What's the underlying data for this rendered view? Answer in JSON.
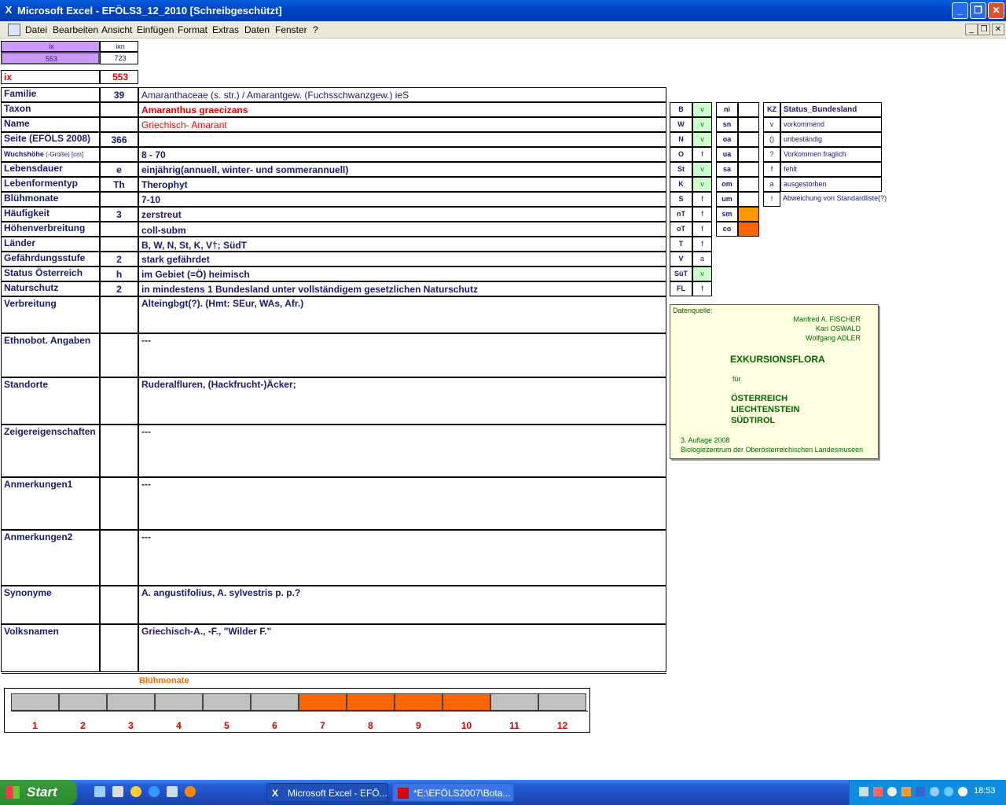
{
  "window": {
    "title": "Microsoft Excel - EFÖLS3_12_2010  [Schreibgeschützt]",
    "min": "_",
    "max": "❐",
    "close": "✕"
  },
  "menu": [
    "Datei",
    "Bearbeiten",
    "Ansicht",
    "Einfügen",
    "Format",
    "Extras",
    "Daten",
    "Fenster",
    "?"
  ],
  "mdi": {
    "min": "_",
    "restore": "❐",
    "close": "✕"
  },
  "index": {
    "ix_head": "ix",
    "ixn_head": "ixn",
    "ix_val": "553",
    "ixn_val": "723",
    "ix_label": "ix",
    "ix_big": "553"
  },
  "rows": [
    {
      "label": "Familie",
      "code": "39",
      "value": "Amaranthaceae (s. str.)  /  Amarantgew. (Fuchsschwanzgew.) ieS"
    },
    {
      "label": "Taxon",
      "code": "",
      "value": "Amaranthus graecizans"
    },
    {
      "label": "Name",
      "code": "",
      "value": "Griechisch- Amarant"
    },
    {
      "label": "Seite (EFÖLS 2008)",
      "code": "366",
      "value": ""
    },
    {
      "label": "Wuchshöhe",
      "label_small": " (-Größe) [cm]",
      "code": "",
      "value": " 8 - 70"
    },
    {
      "label": "Lebensdauer",
      "code": "e",
      "value": "einjährig(annuell, winter- und sommerannuell)"
    },
    {
      "label": "Lebenformentyp",
      "code": "Th",
      "value": "Therophyt"
    },
    {
      "label": "Blühmonate",
      "code": "",
      "value": " 7-10"
    },
    {
      "label": "Häufigkeit",
      "code": "3",
      "value": "zerstreut"
    },
    {
      "label": "Höhenverbreitung",
      "code": "",
      "value": "coll-subm"
    },
    {
      "label": "Länder",
      "code": "",
      "value": "B, W, N, St, K, V†; SüdT"
    },
    {
      "label": "Gefährdungsstufe",
      "code": "2",
      "value": "stark gefährdet"
    },
    {
      "label": "Status Österreich",
      "code": "h",
      "value": "im Gebiet (=Ö) heimisch"
    },
    {
      "label": "Naturschutz",
      "code": "2",
      "value": "in mindestens 1 Bundesland unter vollständigem gesetzlichen Naturschutz"
    }
  ],
  "bigrows": [
    {
      "label": "Verbreitung",
      "value": "Alteingbgt(?). (Hmt: SEur, WAs, Afr.)"
    },
    {
      "label": "Ethnobot. Angaben",
      "value": "---"
    },
    {
      "label": "Standorte",
      "value": "Ruderalfluren, (Hackfrucht-)Äcker;"
    },
    {
      "label": "Zeigereigenschaften",
      "value": "---"
    },
    {
      "label": "Anmerkungen1",
      "value": "---"
    },
    {
      "label": "Anmerkungen2",
      "value": "---"
    },
    {
      "label": "Synonyme",
      "value": "A. angustifolius, A. sylvestris p. p.?"
    },
    {
      "label": "Volksnamen",
      "value": "Griechisch-A., -F., \"Wilder F.\""
    }
  ],
  "laender": [
    {
      "k": "B",
      "v": "v"
    },
    {
      "k": "W",
      "v": "v"
    },
    {
      "k": "N",
      "v": "v"
    },
    {
      "k": "O",
      "v": "f"
    },
    {
      "k": "St",
      "v": "v"
    },
    {
      "k": "K",
      "v": "v"
    },
    {
      "k": "S",
      "v": "f"
    },
    {
      "k": "nT",
      "v": "f"
    },
    {
      "k": "oT",
      "v": "f"
    },
    {
      "k": "T",
      "v": "f"
    },
    {
      "k": "V",
      "v": "a"
    },
    {
      "k": "SüT",
      "v": "v"
    },
    {
      "k": "FL",
      "v": "f"
    }
  ],
  "hoehe": [
    "ni",
    "sn",
    "oa",
    "ua",
    "sa",
    "om",
    "um",
    "sm",
    "co"
  ],
  "legend": {
    "kz": "KZ",
    "status": "Status_Bundesland",
    "items": [
      {
        "k": "v",
        "t": "vorkommend"
      },
      {
        "k": "()",
        "t": "unbeständig"
      },
      {
        "k": "?",
        "t": "Vorkommen fraglich"
      },
      {
        "k": "f",
        "t": "fehlt"
      },
      {
        "k": "a",
        "t": "ausgestorben"
      },
      {
        "k": "!",
        "t": "Abweichung von Standardliste(?)"
      }
    ]
  },
  "book": {
    "source": "Datenquelle:",
    "a1": "Manfred A. FISCHER",
    "a2": "Karl OSWALD",
    "a3": "Wolfgang ADLER",
    "title": "EXKURSIONSFLORA",
    "fuer": "für",
    "c1": "ÖSTERREICH",
    "c2": "LIECHTENSTEIN",
    "c3": "SÜDTIROL",
    "ed": "3. Auflage 2008",
    "pub": "Biologiezentrum der Oberösterreichischen Landesmuseen"
  },
  "chart_data": {
    "type": "bar",
    "title": "Blühmonate",
    "categories": [
      "1",
      "2",
      "3",
      "4",
      "5",
      "6",
      "7",
      "8",
      "9",
      "10",
      "11",
      "12"
    ],
    "values": [
      0,
      0,
      0,
      0,
      0,
      0,
      1,
      1,
      1,
      1,
      0,
      0
    ],
    "colors": {
      "on": "#ff6600",
      "off": "#c0c0c0"
    }
  },
  "taskbar": {
    "start": "Start",
    "t1": "Microsoft Excel - EFÖ...",
    "t2": "*E:\\EFÖLS2007\\Bota...",
    "clock": "18:53"
  }
}
